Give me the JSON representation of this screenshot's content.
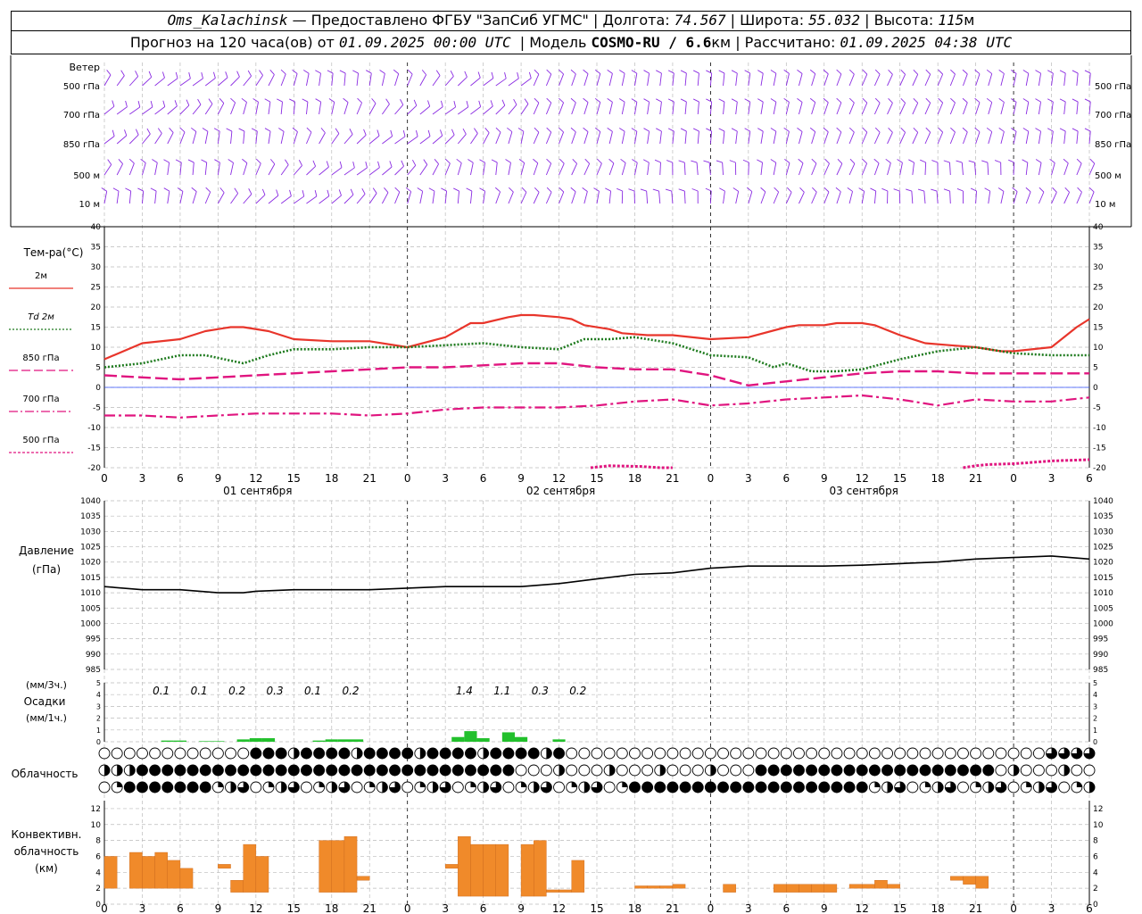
{
  "header": {
    "station": "Oms_Kalachinsk",
    "provider": "— Предоставлено ФГБУ \"ЗапСиб УГМС\"",
    "lon_label": "Долгота:",
    "lon": "74.567",
    "lat_label": "Широта:",
    "lat": "55.032",
    "alt_label": "Высота:",
    "alt": "115",
    "alt_unit": "м",
    "forecast_label": "Прогноз на 120 часа(ов) от",
    "forecast_start": "01.09.2025 00:00 UTC",
    "model_label": "Модель",
    "model": "COSMO-RU / 6.6",
    "model_unit": "км",
    "calc_label": "Рассчитано:",
    "calc_time": "01.09.2025 04:38 UTC"
  },
  "wind_panel": {
    "title": "Ветер",
    "levels": [
      "500 гПа",
      "700 гПа",
      "850 гПа",
      "500 м",
      "10 м"
    ],
    "color": "#8a2be2"
  },
  "temperature_panel": {
    "title": "Тем-ра(°С)",
    "legend": [
      {
        "label": "2м",
        "color": "#e8352b",
        "style": "solid"
      },
      {
        "label": "Td  2м",
        "color": "#1d7a1d",
        "style": "dotted"
      },
      {
        "label": "850 гПа",
        "color": "#e0157f",
        "style": "dashed"
      },
      {
        "label": "700 гПа",
        "color": "#e0157f",
        "style": "dashdot"
      },
      {
        "label": "500 гПа",
        "color": "#e0157f",
        "style": "dense"
      }
    ],
    "yticks": [
      "40",
      "35",
      "30",
      "25",
      "20",
      "15",
      "10",
      "5",
      "0",
      "-5",
      "-10",
      "-15",
      "-20"
    ]
  },
  "x_axis": {
    "ticks": [
      "0",
      "3",
      "6",
      "9",
      "12",
      "15",
      "18",
      "21",
      "0",
      "3",
      "6",
      "9",
      "12",
      "15",
      "18",
      "21",
      "0",
      "3",
      "6",
      "9",
      "12",
      "15",
      "18",
      "21",
      "0",
      "3",
      "6"
    ],
    "days": [
      "01 сентября",
      "02 сентября",
      "03 сентября"
    ]
  },
  "pressure_panel": {
    "title1": "Давление",
    "title2": "(гПа)",
    "yticks": [
      "1040",
      "1035",
      "1030",
      "1025",
      "1020",
      "1015",
      "1010",
      "1005",
      "1000",
      "995",
      "990",
      "985"
    ]
  },
  "precip_panel": {
    "title1": "(мм/3ч.)",
    "title2": "Осадки",
    "title3": "(мм/1ч.)",
    "yticks": [
      "5",
      "4",
      "3",
      "2",
      "1",
      "0"
    ],
    "labels": [
      {
        "h": 4.5,
        "text": "0.1"
      },
      {
        "h": 7.5,
        "text": "0.1"
      },
      {
        "h": 10.5,
        "text": "0.2"
      },
      {
        "h": 13.5,
        "text": "0.3"
      },
      {
        "h": 16.5,
        "text": "0.1"
      },
      {
        "h": 19.5,
        "text": "0.2"
      },
      {
        "h": 28.5,
        "text": "1.4"
      },
      {
        "h": 31.5,
        "text": "1.1"
      },
      {
        "h": 34.5,
        "text": "0.3"
      },
      {
        "h": 37.5,
        "text": "0.2"
      }
    ]
  },
  "cloud_panel": {
    "title": "Облачность"
  },
  "conv_panel": {
    "title1": "Конвективн.",
    "title2": "облачность",
    "title3": "(км)",
    "yticks": [
      "12",
      "10",
      "8",
      "6",
      "4",
      "2",
      "0"
    ]
  },
  "chart_data": {
    "type": "line",
    "x_unit": "hours from 01.09.2025 00:00 UTC",
    "xlim": [
      0,
      78
    ],
    "temperature": {
      "ylim": [
        -20,
        40
      ],
      "series": [
        {
          "name": "2м",
          "x": [
            0,
            3,
            6,
            8,
            10,
            11,
            13,
            15,
            18,
            21,
            24,
            27,
            29,
            30,
            32,
            33,
            34,
            36,
            37,
            38,
            40,
            41,
            43,
            45,
            48,
            51,
            54,
            55,
            57,
            58,
            60,
            61,
            63,
            65,
            67,
            69,
            71,
            72,
            75,
            77,
            78
          ],
          "y": [
            7,
            11,
            12,
            14,
            15,
            15,
            14,
            12,
            11.5,
            11.5,
            10,
            12.5,
            16,
            16,
            17.5,
            18,
            18,
            17.5,
            17,
            15.5,
            14.5,
            13.5,
            13,
            13,
            12,
            12.5,
            15,
            15.5,
            15.5,
            16,
            16,
            15.5,
            13,
            11,
            10.5,
            10,
            9,
            9,
            10,
            15,
            17
          ]
        },
        {
          "name": "Td  2м",
          "x": [
            0,
            3,
            6,
            8,
            11,
            13,
            15,
            18,
            21,
            24,
            27,
            30,
            33,
            36,
            38,
            40,
            42,
            45,
            48,
            51,
            53,
            54,
            56,
            58,
            60,
            63,
            66,
            69,
            72,
            75,
            78
          ],
          "y": [
            5,
            6,
            8,
            8,
            6,
            8,
            9.5,
            9.5,
            10,
            10,
            10.5,
            11,
            10,
            9.5,
            12,
            12,
            12.5,
            11,
            8,
            7.5,
            5,
            6,
            4,
            4,
            4.5,
            7,
            9,
            10,
            8.5,
            8,
            8
          ]
        },
        {
          "name": "850 гПа",
          "x": [
            0,
            3,
            6,
            9,
            12,
            15,
            18,
            21,
            24,
            27,
            30,
            33,
            36,
            39,
            42,
            45,
            48,
            51,
            54,
            57,
            60,
            63,
            66,
            69,
            72,
            75,
            78
          ],
          "y": [
            3,
            2.5,
            2,
            2.5,
            3,
            3.5,
            4,
            4.5,
            5,
            5,
            5.5,
            6,
            6,
            5,
            4.5,
            4.5,
            3,
            0.5,
            1.5,
            2.5,
            3.5,
            4,
            4,
            3.5,
            3.5,
            3.5,
            3.5
          ]
        },
        {
          "name": "700 гПа",
          "x": [
            0,
            3,
            6,
            9,
            12,
            15,
            18,
            21,
            24,
            27,
            30,
            33,
            36,
            39,
            42,
            45,
            48,
            51,
            54,
            57,
            60,
            63,
            66,
            69,
            72,
            75,
            78
          ],
          "y": [
            -7,
            -7,
            -7.5,
            -7,
            -6.5,
            -6.5,
            -6.5,
            -7,
            -6.5,
            -5.5,
            -5,
            -5,
            -5,
            -4.5,
            -3.5,
            -3,
            -4.5,
            -4,
            -3,
            -2.5,
            -2,
            -3,
            -4.5,
            -3,
            -3.5,
            -3.5,
            -2.5
          ]
        },
        {
          "name": "500 гПа",
          "x": [
            38.5,
            40,
            42.5,
            44,
            44.5,
            45
          ],
          "y": [
            -20,
            -19.5,
            -19.7,
            -20,
            -20,
            -20
          ],
          "x2": [
            68,
            69,
            70,
            72,
            73,
            75,
            76,
            78
          ],
          "y2": [
            -20,
            -19.5,
            -19.2,
            -19,
            -18.8,
            -18.3,
            -18.2,
            -18
          ]
        }
      ]
    },
    "pressure": {
      "ylim": [
        985,
        1040
      ],
      "x": [
        0,
        3,
        6,
        9,
        11,
        12,
        15,
        18,
        21,
        24,
        27,
        30,
        33,
        36,
        39,
        42,
        45,
        48,
        51,
        54,
        57,
        60,
        63,
        66,
        69,
        72,
        75,
        78
      ],
      "y": [
        1012,
        1011,
        1011,
        1010,
        1010,
        1010.5,
        1011,
        1011,
        1011,
        1011.5,
        1012,
        1012,
        1012,
        1013,
        1014.5,
        1016,
        1016.5,
        1018,
        1018.7,
        1018.7,
        1018.7,
        1019,
        1019.5,
        1020,
        1021,
        1021.5,
        1022,
        1021
      ]
    },
    "precip_hourly": {
      "ylim": [
        0,
        5
      ],
      "x": [
        5,
        6,
        8,
        9,
        11,
        12,
        13,
        17,
        18,
        19,
        20,
        28,
        29,
        30,
        32,
        33,
        36
      ],
      "y": [
        0.1,
        0.1,
        0.05,
        0.05,
        0.2,
        0.3,
        0.3,
        0.1,
        0.2,
        0.2,
        0.2,
        0.4,
        0.9,
        0.3,
        0.8,
        0.4,
        0.2
      ]
    },
    "convective": {
      "ylim": [
        0,
        13
      ],
      "bars": [
        {
          "h": 0.5,
          "base": 2,
          "top": 6
        },
        {
          "h": 2.5,
          "base": 2,
          "top": 6.5
        },
        {
          "h": 3.5,
          "base": 2,
          "top": 6
        },
        {
          "h": 4.5,
          "base": 2,
          "top": 6.5
        },
        {
          "h": 5.5,
          "base": 2,
          "top": 5.5
        },
        {
          "h": 6.5,
          "base": 2,
          "top": 4.5
        },
        {
          "h": 9.5,
          "base": 4.5,
          "top": 5
        },
        {
          "h": 10.5,
          "base": 1.5,
          "top": 3
        },
        {
          "h": 11.5,
          "base": 1.5,
          "top": 7.5
        },
        {
          "h": 12.5,
          "base": 1.5,
          "top": 6
        },
        {
          "h": 17.5,
          "base": 1.5,
          "top": 8
        },
        {
          "h": 18.5,
          "base": 1.5,
          "top": 8
        },
        {
          "h": 19.5,
          "base": 1.5,
          "top": 8.5
        },
        {
          "h": 20.5,
          "base": 3,
          "top": 3.5
        },
        {
          "h": 27.5,
          "base": 4.5,
          "top": 5
        },
        {
          "h": 28.5,
          "base": 1,
          "top": 8.5
        },
        {
          "h": 29.5,
          "base": 1,
          "top": 7.5
        },
        {
          "h": 30.5,
          "base": 1,
          "top": 7.5
        },
        {
          "h": 31.5,
          "base": 1,
          "top": 7.5
        },
        {
          "h": 33.5,
          "base": 1,
          "top": 7.5
        },
        {
          "h": 34.5,
          "base": 1,
          "top": 8
        },
        {
          "h": 35.5,
          "base": 1.5,
          "top": 1.8
        },
        {
          "h": 36.5,
          "base": 1.5,
          "top": 1.8
        },
        {
          "h": 37.5,
          "base": 1.5,
          "top": 5.5
        },
        {
          "h": 42.5,
          "base": 2,
          "top": 2.3
        },
        {
          "h": 43.5,
          "base": 2,
          "top": 2.3
        },
        {
          "h": 44.5,
          "base": 2,
          "top": 2.3
        },
        {
          "h": 45.5,
          "base": 2,
          "top": 2.5
        },
        {
          "h": 49.5,
          "base": 1.5,
          "top": 2.5
        },
        {
          "h": 53.5,
          "base": 1.5,
          "top": 2.5
        },
        {
          "h": 54.5,
          "base": 1.5,
          "top": 2.5
        },
        {
          "h": 55.5,
          "base": 1.5,
          "top": 2.5
        },
        {
          "h": 56.5,
          "base": 1.5,
          "top": 2.5
        },
        {
          "h": 57.5,
          "base": 1.5,
          "top": 2.5
        },
        {
          "h": 59.5,
          "base": 2,
          "top": 2.5
        },
        {
          "h": 60.5,
          "base": 2,
          "top": 2.5
        },
        {
          "h": 61.5,
          "base": 2,
          "top": 3
        },
        {
          "h": 62.5,
          "base": 2,
          "top": 2.5
        },
        {
          "h": 67.5,
          "base": 3,
          "top": 3.5
        },
        {
          "h": 68.5,
          "base": 2.5,
          "top": 3.5
        },
        {
          "h": 69.5,
          "base": 2,
          "top": 3.5
        }
      ]
    }
  }
}
